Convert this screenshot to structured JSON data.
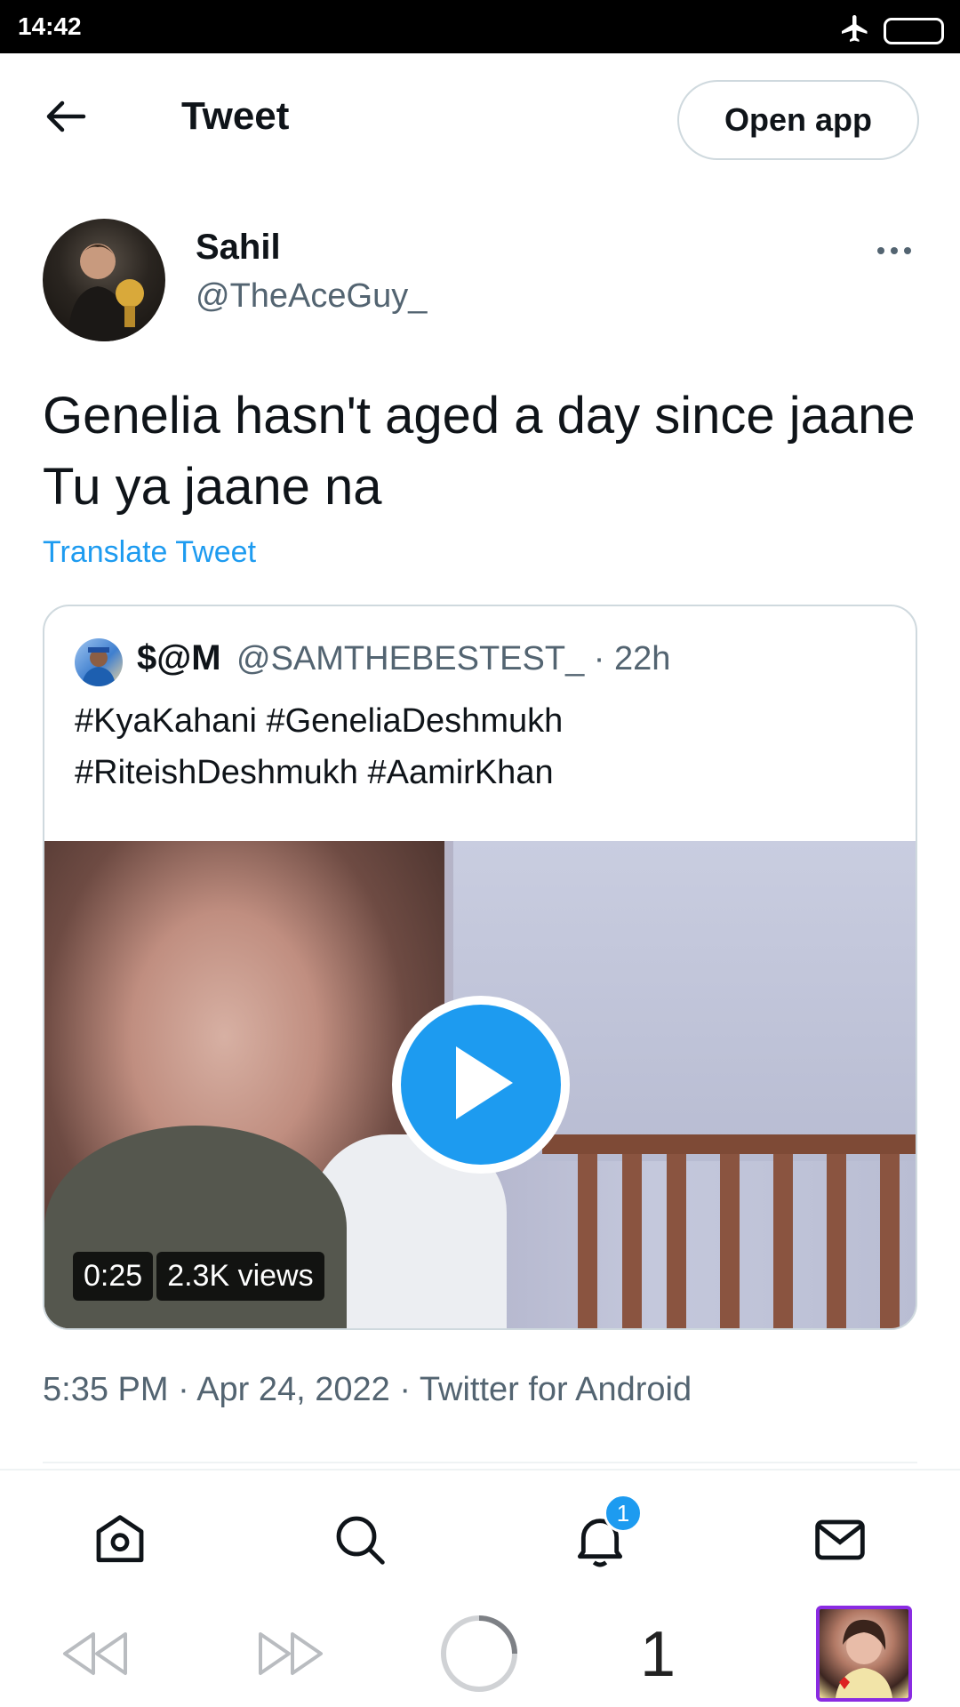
{
  "status_bar": {
    "time": "14:42",
    "icons": [
      "airplane-icon",
      "battery-icon"
    ]
  },
  "header": {
    "back_icon": "arrow-left-icon",
    "title": "Tweet",
    "open_app_label": "Open app"
  },
  "tweet": {
    "author_name": "Sahil",
    "author_handle": "@TheAceGuy_",
    "text": "Genelia hasn't aged a day since jaane Tu ya jaane na",
    "translate_label": "Translate Tweet",
    "timestamp": "5:35 PM · Apr 24, 2022 · Twitter for Android"
  },
  "quoted_tweet": {
    "author_name": "$@M",
    "author_handle": "@SAMTHEBESTEST_ · 22h",
    "text_line1": "#KyaKahani #GeneliaDeshmukh",
    "text_line2": "#RiteishDeshmukh #AamirKhan",
    "video_duration": "0:25",
    "video_views": "2.3K views"
  },
  "bottom_nav": {
    "items": [
      "home-icon",
      "search-icon",
      "notifications-icon",
      "messages-icon"
    ],
    "notification_count": "1"
  },
  "browser_bar": {
    "tab_count": "1"
  },
  "colors": {
    "accent": "#1d9bf0",
    "secondary_text": "#536471",
    "primary_text": "#0f1419",
    "border": "#cfd9de"
  }
}
